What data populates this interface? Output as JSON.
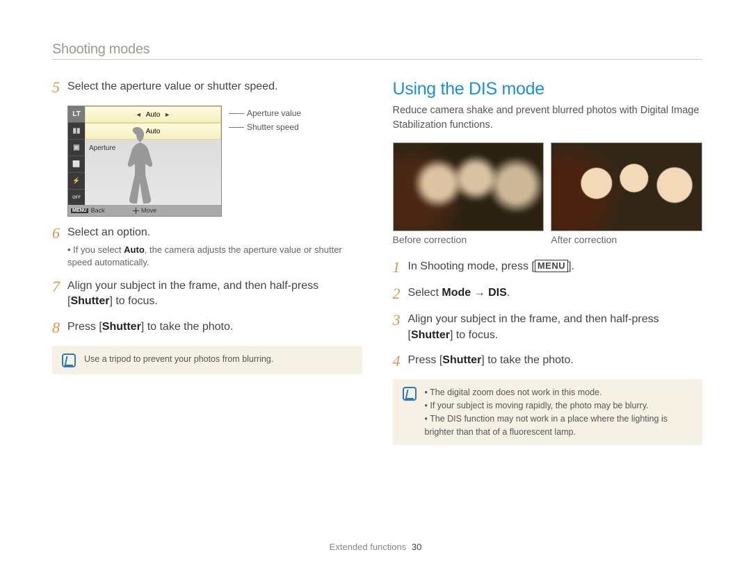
{
  "header": {
    "title": "Shooting modes"
  },
  "left": {
    "step5": {
      "num": "5",
      "text": "Select the aperture value or shutter speed."
    },
    "lcd": {
      "sidebar": [
        "LT",
        "▮▮",
        "▣",
        "⬜",
        "⚡",
        "OFF"
      ],
      "row1": {
        "left_arrow": "◄",
        "value": "Auto",
        "right_arrow": "►"
      },
      "row2": {
        "value": "Auto"
      },
      "row3": {
        "label": "Aperture"
      },
      "bottom": {
        "menu": "MENU",
        "back": "Back",
        "move": "Move"
      },
      "callouts": {
        "aperture": "Aperture value",
        "shutter": "Shutter speed"
      }
    },
    "step6": {
      "num": "6",
      "text": "Select an option.",
      "sub_prefix": "If you select ",
      "sub_bold": "Auto",
      "sub_suffix": ", the camera adjusts the aperture value or shutter speed automatically."
    },
    "step7": {
      "num": "7",
      "text_a": "Align your subject in the frame, and then half-press [",
      "bold": "Shutter",
      "text_b": "] to focus."
    },
    "step8": {
      "num": "8",
      "text_a": "Press [",
      "bold": "Shutter",
      "text_b": "] to take the photo."
    },
    "note": {
      "text": "Use a tripod to prevent your photos from blurring."
    }
  },
  "right": {
    "title": "Using the DIS mode",
    "intro": "Reduce camera shake and prevent blurred photos with Digital Image Stabilization functions.",
    "labels": {
      "before": "Before correction",
      "after": "After correction"
    },
    "step1": {
      "num": "1",
      "text_a": "In Shooting mode, press [",
      "menu": "MENU",
      "text_b": "]."
    },
    "step2": {
      "num": "2",
      "text_a": "Select ",
      "bold1": "Mode",
      "arrow": " → ",
      "bold2": "DIS",
      "text_b": "."
    },
    "step3": {
      "num": "3",
      "text_a": "Align your subject in the frame, and then half-press [",
      "bold": "Shutter",
      "text_b": "] to focus."
    },
    "step4": {
      "num": "4",
      "text_a": "Press [",
      "bold": "Shutter",
      "text_b": "] to take the photo."
    },
    "note": {
      "items": [
        "The digital zoom does not work in this mode.",
        "If your subject is moving rapidly, the photo may be blurry.",
        "The DIS function may not work in a place where the lighting is brighter than that of a fluorescent lamp."
      ]
    }
  },
  "footer": {
    "section": "Extended functions",
    "page": "30"
  }
}
